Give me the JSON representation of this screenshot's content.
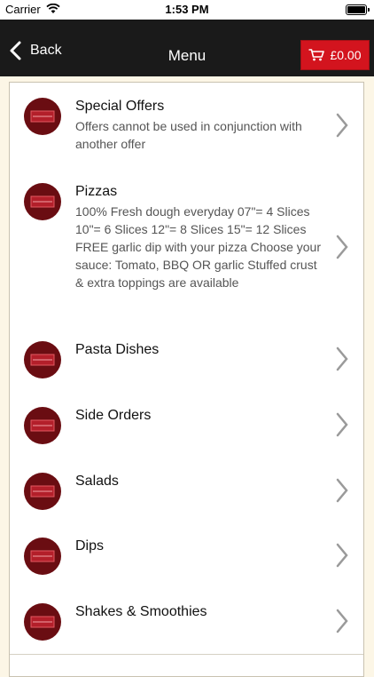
{
  "status_bar": {
    "carrier": "Carrier",
    "time": "1:53 PM"
  },
  "navbar": {
    "back_label": "Back",
    "title": "Menu",
    "cart_total": "£0.00"
  },
  "colors": {
    "navbar_bg": "#1a1a1a",
    "cart_button": "#d3141e",
    "badge": "#6a0d12",
    "page_bg": "#fcf6e6"
  },
  "menu": {
    "items": [
      {
        "title": "Special Offers",
        "description": "Offers cannot be used in conjunction with another offer",
        "icon": "menu-badge-icon"
      },
      {
        "title": "Pizzas",
        "description": "100% Fresh dough everyday 07\"= 4 Slices 10\"= 6 Slices 12\"= 8 Slices 15\"= 12 Slices FREE garlic dip with your pizza Choose your sauce: Tomato, BBQ OR garlic Stuffed crust & extra toppings are available",
        "icon": "menu-badge-icon"
      },
      {
        "title": "Pasta Dishes",
        "description": "",
        "icon": "menu-badge-icon"
      },
      {
        "title": "Side Orders",
        "description": "",
        "icon": "menu-badge-icon"
      },
      {
        "title": "Salads",
        "description": "",
        "icon": "menu-badge-icon"
      },
      {
        "title": "Dips",
        "description": "",
        "icon": "menu-badge-icon"
      },
      {
        "title": "Shakes & Smoothies",
        "description": "",
        "icon": "menu-badge-icon"
      }
    ]
  }
}
